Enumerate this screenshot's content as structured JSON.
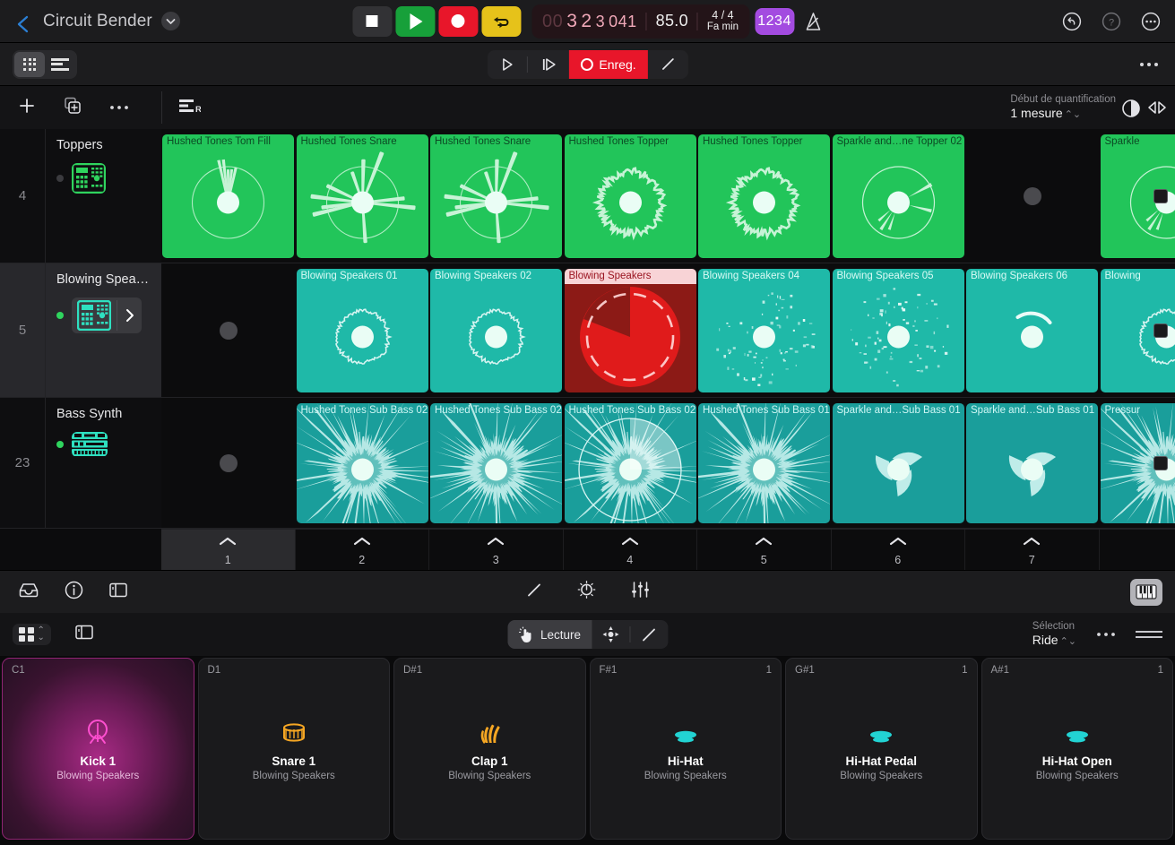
{
  "topbar": {
    "back_icon": "chevron-left-icon",
    "project_title": "Circuit Bender",
    "disclosure_icon": "chevron-down-icon",
    "transport": {
      "stop_label": "stop-icon",
      "play_label": "play-icon",
      "record_label": "record-icon",
      "cycle_label": "cycle-icon"
    },
    "lcd": {
      "position_dim": "00",
      "bar": "3",
      "beat": "2",
      "division": "3",
      "ticks": "041",
      "tempo": "85.0",
      "time_signature": "4 / 4",
      "key": "Fa min"
    },
    "count_in": "1234",
    "metronome_icon": "metronome-icon",
    "undo_icon": "undo-icon",
    "help_icon": "help-icon",
    "more_icon": "more-icon"
  },
  "bar2": {
    "view_grid_icon": "grid-view-icon",
    "view_tracks_icon": "tracks-view-icon",
    "play_icon": "play-icon",
    "play_from_start_icon": "play-from-start-icon",
    "record_label": "Enreg.",
    "pencil_icon": "pencil-icon",
    "more_icon": "more-icon"
  },
  "bar3": {
    "add_icon": "plus-icon",
    "duplicate_icon": "duplicate-icon",
    "more_icon": "more-icon",
    "region_icon": "region-r-icon",
    "quantize_start_label": "Début de quantification",
    "quantize_start_value": "1 mesure",
    "quantize_icon": "quantize-pie-icon",
    "loop_arrows_icon": "loop-arrows-icon"
  },
  "tracks": [
    {
      "number": "4",
      "name": "Toppers",
      "selected": false,
      "enabled": false,
      "instrument_icon": "drum-machine-icon",
      "instrument_color": "#2fd45e",
      "cell_color": "#22c55a",
      "caption_color": "#0c4a24",
      "wave_color": "#c7f3d6",
      "cells": [
        {
          "label": "Hushed Tones Tom Fill",
          "state": "loaded",
          "shape": "tomfill"
        },
        {
          "label": "Hushed Tones Snare",
          "state": "loaded",
          "shape": "snare"
        },
        {
          "label": "Hushed Tones Snare",
          "state": "loaded",
          "shape": "snare"
        },
        {
          "label": "Hushed Tones Topper",
          "state": "loaded",
          "shape": "topper"
        },
        {
          "label": "Hushed Tones Topper",
          "state": "loaded",
          "shape": "topper"
        },
        {
          "label": "Sparkle and…ne Topper 02",
          "state": "loaded",
          "shape": "sparkle"
        },
        {
          "label": "",
          "state": "empty",
          "shape": "none"
        },
        {
          "label": "Sparkle",
          "state": "loaded",
          "shape": "sparkle"
        }
      ]
    },
    {
      "number": "5",
      "name": "Blowing Spea…",
      "selected": true,
      "enabled": true,
      "instrument_icon": "drum-machine-icon",
      "instrument_color": "#2ee0c0",
      "cell_color": "#1fb9a8",
      "caption_color": "#d9fbf5",
      "wave_color": "#eafbf8",
      "cells": [
        {
          "label": "",
          "state": "empty",
          "shape": "none"
        },
        {
          "label": "Blowing Speakers 01",
          "state": "loaded",
          "shape": "blip"
        },
        {
          "label": "Blowing Speakers 02",
          "state": "loaded",
          "shape": "blip"
        },
        {
          "label": "Blowing Speakers",
          "state": "recording",
          "shape": "pie"
        },
        {
          "label": "Blowing Speakers 04",
          "state": "loaded",
          "shape": "speckle"
        },
        {
          "label": "Blowing Speakers 05",
          "state": "loaded",
          "shape": "speckle2"
        },
        {
          "label": "Blowing Speakers 06",
          "state": "loaded",
          "shape": "arc"
        },
        {
          "label": "Blowing",
          "state": "loaded",
          "shape": "blip"
        }
      ]
    },
    {
      "number": "23",
      "name": "Bass Synth",
      "selected": false,
      "enabled": true,
      "instrument_icon": "synth-rack-icon",
      "instrument_color": "#2ee0c0",
      "cell_color": "#1a9e9b",
      "caption_color": "#cdf6f4",
      "wave_color": "#bfece9",
      "cells": [
        {
          "label": "",
          "state": "empty",
          "shape": "none"
        },
        {
          "label": "Hushed Tones Sub Bass 02",
          "state": "loaded",
          "shape": "fuzz"
        },
        {
          "label": "Hushed Tones Sub Bass 02",
          "state": "loaded",
          "shape": "fuzz2"
        },
        {
          "label": "Hushed Tones Sub Bass 02",
          "state": "playing",
          "shape": "fuzz"
        },
        {
          "label": "Hushed Tones Sub Bass 01",
          "state": "loaded",
          "shape": "fuzz2"
        },
        {
          "label": "Sparkle and…Sub Bass 01",
          "state": "loaded",
          "shape": "swirl"
        },
        {
          "label": "Sparkle and…Sub Bass 01",
          "state": "loaded",
          "shape": "swirl"
        },
        {
          "label": "Pressur",
          "state": "loaded",
          "shape": "fuzz"
        }
      ]
    }
  ],
  "scenes": [
    {
      "number": "1",
      "highlighted": true
    },
    {
      "number": "2",
      "highlighted": false
    },
    {
      "number": "3",
      "highlighted": false
    },
    {
      "number": "4",
      "highlighted": false
    },
    {
      "number": "5",
      "highlighted": false
    },
    {
      "number": "6",
      "highlighted": false
    },
    {
      "number": "7",
      "highlighted": false
    }
  ],
  "midbar": {
    "browser_icon": "browser-tray-icon",
    "info_icon": "info-icon",
    "panel_icon": "side-panel-icon",
    "pencil_icon": "pencil-icon",
    "automation_icon": "automation-icon",
    "mixer_icon": "mixer-faders-icon",
    "keyboard_icon": "piano-keyboard-icon"
  },
  "botbar": {
    "layout_icon": "pad-layout-icon",
    "layout_stepper_icon": "stepper-icon",
    "panel_icon": "side-panel-icon",
    "mode_label": "Lecture",
    "mode_icon": "tap-hand-icon",
    "move_icon": "move-tool-icon",
    "pencil_icon": "pencil-icon",
    "selection_label": "Sélection",
    "selection_value": "Ride",
    "more_icon": "more-icon",
    "resize_icon": "resize-handle-icon"
  },
  "pads": [
    {
      "note": "C1",
      "velocity": "",
      "name": "Kick 1",
      "kit": "Blowing Speakers",
      "icon": "kick-drum-icon",
      "lit": true,
      "icon_color": "#ff4fd0"
    },
    {
      "note": "D1",
      "velocity": "",
      "name": "Snare 1",
      "kit": "Blowing Speakers",
      "icon": "snare-drum-icon",
      "lit": false,
      "icon_color": "#f5a623"
    },
    {
      "note": "D#1",
      "velocity": "",
      "name": "Clap 1",
      "kit": "Blowing Speakers",
      "icon": "clap-hand-icon",
      "lit": false,
      "icon_color": "#f5a623"
    },
    {
      "note": "F#1",
      "velocity": "1",
      "name": "Hi-Hat",
      "kit": "Blowing Speakers",
      "icon": "hihat-icon",
      "lit": false,
      "icon_color": "#22d3d3"
    },
    {
      "note": "G#1",
      "velocity": "1",
      "name": "Hi-Hat Pedal",
      "kit": "Blowing Speakers",
      "icon": "hihat-icon",
      "lit": false,
      "icon_color": "#22d3d3"
    },
    {
      "note": "A#1",
      "velocity": "1",
      "name": "Hi-Hat Open",
      "kit": "Blowing Speakers",
      "icon": "hihat-icon",
      "lit": false,
      "icon_color": "#22d3d3"
    }
  ],
  "colors": {
    "record_red": "#e8162a",
    "play_green": "#17a03a",
    "cycle_yellow": "#e6c21a",
    "count_in_purple": "#a34be0",
    "track_green": "#22c55a",
    "track_teal": "#1fb9a8",
    "track_bass_teal": "#1a9e9b",
    "pad_pink": "#ff4fd0"
  }
}
